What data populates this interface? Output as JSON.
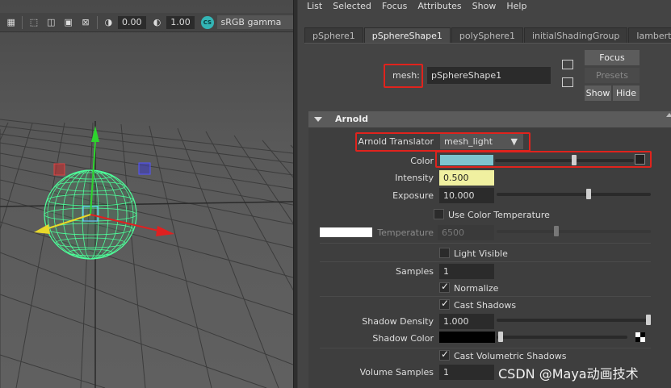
{
  "viewport": {
    "toolbar": {
      "field1": "0.00",
      "field2": "1.00",
      "color_space_icon_label": "CS",
      "color_space": "sRGB gamma"
    }
  },
  "attribute_editor": {
    "menu": [
      "List",
      "Selected",
      "Focus",
      "Attributes",
      "Show",
      "Help"
    ],
    "tabs": [
      {
        "label": "pSphere1",
        "active": false
      },
      {
        "label": "pSphereShape1",
        "active": true
      },
      {
        "label": "polySphere1",
        "active": false
      },
      {
        "label": "initialShadingGroup",
        "active": false
      },
      {
        "label": "lambert1",
        "active": false
      }
    ],
    "node_type_label": "mesh:",
    "node_name": "pSphereShape1",
    "buttons": {
      "focus": "Focus",
      "presets": "Presets",
      "show": "Show",
      "hide": "Hide"
    },
    "section_title": "Arnold",
    "arnold": {
      "translator_label": "Arnold Translator",
      "translator_value": "mesh_light",
      "color_label": "Color",
      "color_value": "#7ec4cf",
      "intensity_label": "Intensity",
      "intensity_value": "0.500",
      "exposure_label": "Exposure",
      "exposure_value": "10.000",
      "use_color_temp_label": "Use Color Temperature",
      "use_color_temp_checked": false,
      "temperature_label": "Temperature",
      "temperature_value": "6500",
      "light_visible_label": "Light Visible",
      "light_visible_checked": false,
      "samples_label": "Samples",
      "samples_value": "1",
      "normalize_label": "Normalize",
      "normalize_checked": true,
      "cast_shadows_label": "Cast Shadows",
      "cast_shadows_checked": true,
      "shadow_density_label": "Shadow Density",
      "shadow_density_value": "1.000",
      "shadow_color_label": "Shadow Color",
      "shadow_color_value": "#000000",
      "cast_volumetric_label": "Cast Volumetric Shadows",
      "cast_volumetric_checked": true,
      "volume_samples_label": "Volume Samples",
      "volume_samples_value": "1"
    }
  },
  "watermark": "CSDN @Maya动画技术"
}
